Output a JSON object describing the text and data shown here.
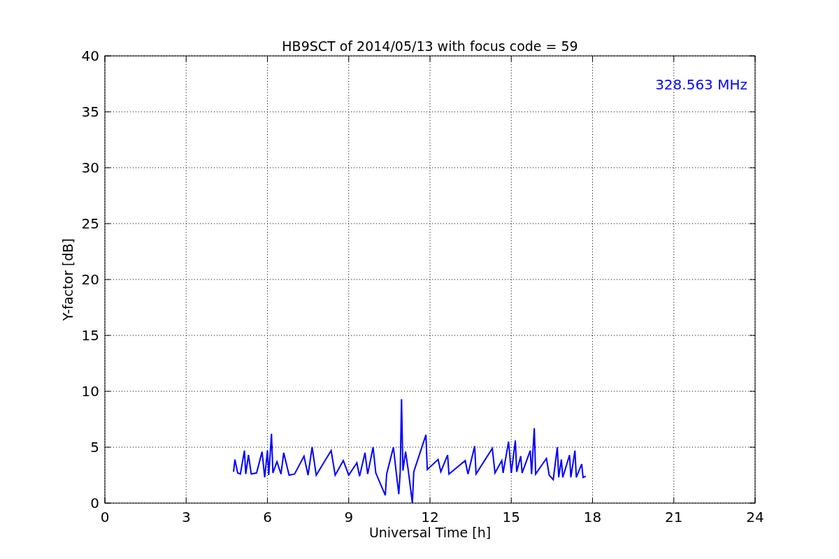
{
  "chart_data": {
    "type": "line",
    "title": "HB9SCT of 2014/05/13 with focus code = 59",
    "xlabel": "Universal Time [h]",
    "ylabel": "Y-factor [dB]",
    "x": [
      4.75,
      4.8,
      4.9,
      5.0,
      5.15,
      5.2,
      5.3,
      5.4,
      5.6,
      5.8,
      5.9,
      6.0,
      6.05,
      6.15,
      6.2,
      6.35,
      6.5,
      6.6,
      6.8,
      7.0,
      7.35,
      7.5,
      7.65,
      7.8,
      8.35,
      8.5,
      8.8,
      9.0,
      9.3,
      9.4,
      9.6,
      9.7,
      9.9,
      10.0,
      10.35,
      10.4,
      10.65,
      10.75,
      10.85,
      10.9,
      10.95,
      11.0,
      11.1,
      11.2,
      11.35,
      11.4,
      11.85,
      11.9,
      12.3,
      12.4,
      12.65,
      12.7,
      13.3,
      13.4,
      13.65,
      13.7,
      14.3,
      14.4,
      14.65,
      14.7,
      14.9,
      15.0,
      15.15,
      15.2,
      15.35,
      15.4,
      15.7,
      15.75,
      15.85,
      15.9,
      16.3,
      16.4,
      16.55,
      16.7,
      16.75,
      16.85,
      16.9,
      17.15,
      17.2,
      17.35,
      17.4,
      17.6,
      17.65,
      17.75
    ],
    "series": [
      {
        "color": "#0000ff",
        "values": [
          2.8,
          3.9,
          2.7,
          2.6,
          4.7,
          2.6,
          4.3,
          2.6,
          2.7,
          4.6,
          2.3,
          4.7,
          2.5,
          6.2,
          2.7,
          3.7,
          2.6,
          4.5,
          2.5,
          2.6,
          4.2,
          2.5,
          5.0,
          2.5,
          4.7,
          2.5,
          3.8,
          2.5,
          3.6,
          2.4,
          4.5,
          2.6,
          5.0,
          2.7,
          0.7,
          2.6,
          5.0,
          2.8,
          0.8,
          2.8,
          9.3,
          2.9,
          4.6,
          2.9,
          0.0,
          2.8,
          6.1,
          3.0,
          3.9,
          2.8,
          4.3,
          2.6,
          3.8,
          2.6,
          5.1,
          2.6,
          4.9,
          2.7,
          3.8,
          2.7,
          5.5,
          2.7,
          5.6,
          2.8,
          4.2,
          2.7,
          4.7,
          2.6,
          6.7,
          2.6,
          4.0,
          2.5,
          2.1,
          5.0,
          2.3,
          3.9,
          2.3,
          4.3,
          2.3,
          4.7,
          2.3,
          3.5,
          2.3,
          2.4
        ]
      }
    ],
    "xlim": [
      0,
      24
    ],
    "ylim": [
      0,
      40
    ],
    "xticks": [
      0,
      3,
      6,
      9,
      12,
      15,
      18,
      21,
      24
    ],
    "yticks": [
      0,
      5,
      10,
      15,
      20,
      25,
      30,
      35,
      40
    ],
    "grid": true,
    "annotations": [
      "328.563 MHz"
    ]
  }
}
